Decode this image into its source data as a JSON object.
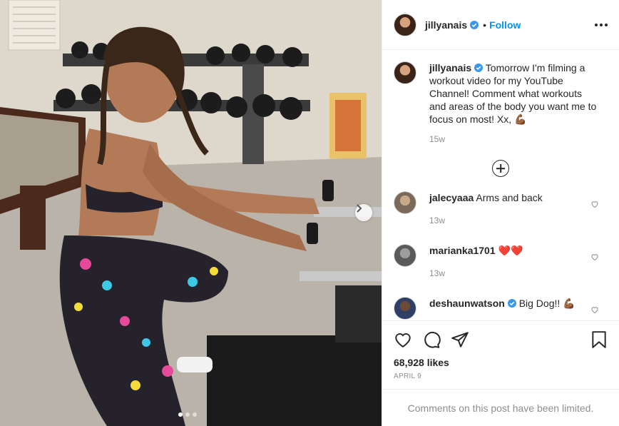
{
  "header": {
    "username": "jillyanais",
    "separator": "•",
    "follow_label": "Follow"
  },
  "caption": {
    "username": "jillyanais",
    "text": "Tomorrow I'm filming a workout video for my YouTube Channel! Comment what workouts and areas of the body you want me to focus on most! Xx, 💪🏾",
    "time": "15w"
  },
  "comments": [
    {
      "username": "jalecyaaa",
      "text": "Arms and back",
      "time": "13w"
    },
    {
      "username": "marianka1701",
      "text": "❤️❤️",
      "time": "13w"
    },
    {
      "username": "deshaunwatson",
      "text": "Big Dog!! 💪🏾",
      "time": ""
    }
  ],
  "stats": {
    "likes": "68,928 likes",
    "date": "APRIL 9"
  },
  "footer": {
    "limited_text": "Comments on this post have been limited."
  },
  "colors": {
    "accent": "#0095f6",
    "verified": "#3897f0",
    "muted": "#8e8e8e",
    "text": "#262626"
  },
  "icons": [
    "verified-badge-icon",
    "more-options-icon",
    "load-more-comments-icon",
    "heart-icon",
    "comment-icon",
    "share-icon",
    "bookmark-icon",
    "next-arrow-icon"
  ]
}
